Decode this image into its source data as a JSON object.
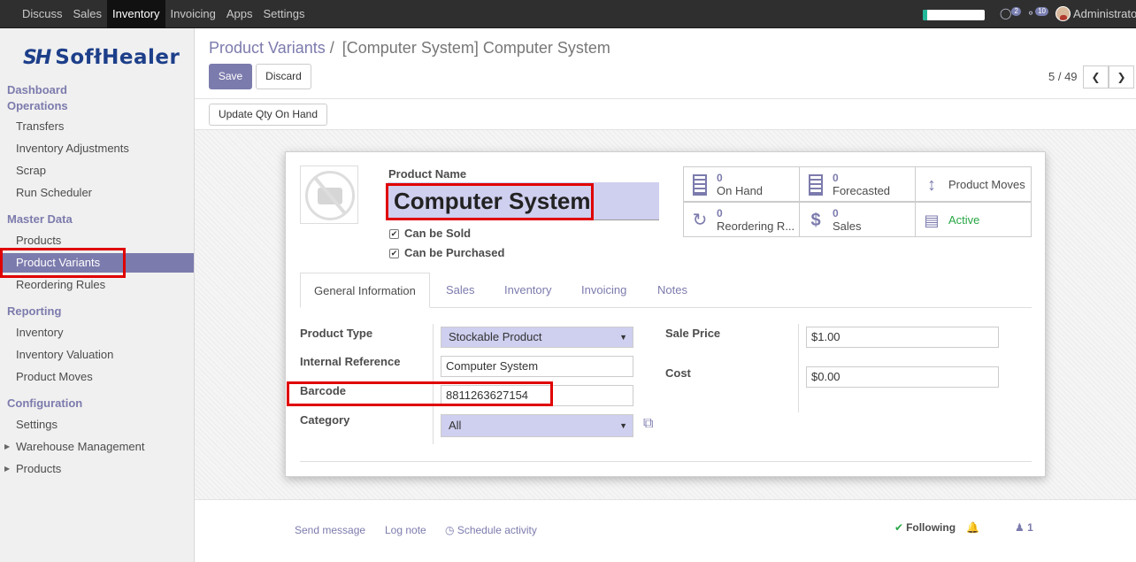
{
  "topbar": {
    "menu": [
      "Discuss",
      "Sales",
      "Inventory",
      "Invoicing",
      "Apps",
      "Settings"
    ],
    "active": "Inventory",
    "progress_fraction": 0.07,
    "chat_count": "2",
    "activity_count": "10",
    "user": "Administrator"
  },
  "sidebar": {
    "logo_mark": "SH",
    "logo_text": "SofłHealer",
    "items": [
      {
        "label": "Dashboard",
        "kind": "head"
      },
      {
        "label": "Operations",
        "kind": "head"
      },
      {
        "label": "Transfers",
        "kind": "sub"
      },
      {
        "label": "Inventory Adjustments",
        "kind": "sub"
      },
      {
        "label": "Scrap",
        "kind": "sub"
      },
      {
        "label": "Run Scheduler",
        "kind": "sub"
      },
      {
        "label": "Master Data",
        "kind": "head"
      },
      {
        "label": "Products",
        "kind": "sub"
      },
      {
        "label": "Product Variants",
        "kind": "sub",
        "active": true
      },
      {
        "label": "Reordering Rules",
        "kind": "sub"
      },
      {
        "label": "Reporting",
        "kind": "head"
      },
      {
        "label": "Inventory",
        "kind": "sub"
      },
      {
        "label": "Inventory Valuation",
        "kind": "sub"
      },
      {
        "label": "Product Moves",
        "kind": "sub"
      },
      {
        "label": "Configuration",
        "kind": "head"
      },
      {
        "label": "Settings",
        "kind": "sub"
      },
      {
        "label": "Warehouse Management",
        "kind": "sub",
        "collapsible": true
      },
      {
        "label": "Products",
        "kind": "sub",
        "collapsible": true
      }
    ]
  },
  "control_panel": {
    "breadcrumb_parent": "Product Variants",
    "breadcrumb_sep": "/",
    "breadcrumb_current": "[Computer System] Computer System",
    "save_label": "Save",
    "discard_label": "Discard",
    "pager": "5 / 49",
    "update_qty_label": "Update Qty On Hand"
  },
  "form": {
    "product_name_label": "Product Name",
    "product_name": "Computer System",
    "can_be_sold_label": "Can be Sold",
    "can_be_sold": true,
    "can_be_purchased_label": "Can be Purchased",
    "can_be_purchased": true,
    "stats": [
      {
        "value": "0",
        "label": "On Hand",
        "icon": "building-icon"
      },
      {
        "value": "0",
        "label": "Forecasted",
        "icon": "building-icon"
      },
      {
        "value": "",
        "label": "Product Moves",
        "icon": "arrows-v-icon"
      },
      {
        "value": "0",
        "label": "Reordering R...",
        "icon": "refresh-icon"
      },
      {
        "value": "0",
        "label": "Sales",
        "icon": "dollar-icon"
      },
      {
        "value": "",
        "label": "Active",
        "icon": "archive-icon",
        "color": "#28a745"
      }
    ],
    "tabs": [
      "General Information",
      "Sales",
      "Inventory",
      "Invoicing",
      "Notes"
    ],
    "active_tab": "General Information",
    "fields": {
      "product_type_label": "Product Type",
      "product_type": "Stockable Product",
      "internal_ref_label": "Internal Reference",
      "internal_ref": "Computer System",
      "barcode_label": "Barcode",
      "barcode": "8811263627154",
      "category_label": "Category",
      "category": "All",
      "sale_price_label": "Sale Price",
      "sale_price": "$1.00",
      "cost_label": "Cost",
      "cost": "$0.00"
    }
  },
  "chatter": {
    "send_message": "Send message",
    "log_note": "Log note",
    "schedule_activity": "Schedule activity",
    "following": "Following",
    "followers": "1"
  },
  "colors": {
    "brand": "#7c7bad",
    "highlight": "#e00000",
    "topbar": "#2f2f2f"
  }
}
